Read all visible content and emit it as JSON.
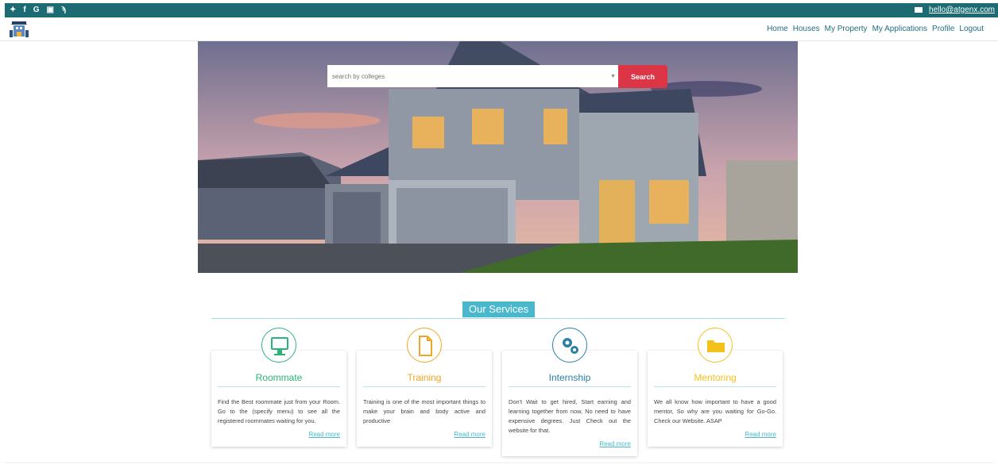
{
  "topbar": {
    "social_icons": [
      "twitter-icon",
      "facebook-icon",
      "google-icon",
      "linkedin-icon",
      "rss-icon"
    ],
    "email": "hello@atgenx.com",
    "color": "#1c6b73"
  },
  "nav": {
    "items": [
      "Home",
      "Houses",
      "My Property",
      "My Applications",
      "Profile",
      "Logout"
    ]
  },
  "search": {
    "placeholder": "search by colleges",
    "button": "Search"
  },
  "services": {
    "title": "Our Services",
    "cards": [
      {
        "title": "Roommate",
        "text": "Find the Best roommate just from your Room. Go to the (specify menu) to see all the registered roommates waiting for you.",
        "more": "Read more",
        "color": "#2bb37a",
        "icon": "monitor-icon"
      },
      {
        "title": "Training",
        "text": "Training is one of the most important things to make your brain and body active and productive",
        "more": "Read more",
        "color": "#f0a624",
        "icon": "document-icon"
      },
      {
        "title": "Internship",
        "text": "Don't Wait to get hired, Start earning and learning together from now, No need to have expensive degrees. Just Check out the website for that.",
        "more": "Read more",
        "color": "#2c7fa7",
        "icon": "gears-icon"
      },
      {
        "title": "Mentoring",
        "text": "We all know how important to have a good mentor, So why are you waiting for Go-Go. Check our Website. ASAP",
        "more": "Read more",
        "color": "#f2c21a",
        "icon": "folder-icon"
      }
    ]
  }
}
